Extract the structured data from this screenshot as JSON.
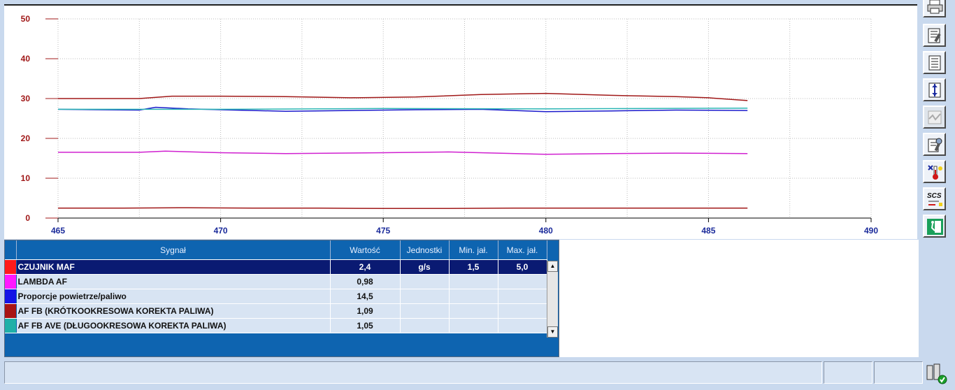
{
  "chart_data": {
    "type": "line",
    "xlim": [
      465,
      490
    ],
    "ylim": [
      0,
      50
    ],
    "x_ticks": [
      "465",
      "470",
      "475",
      "480",
      "485",
      "490"
    ],
    "y_ticks": [
      "0",
      "10",
      "20",
      "30",
      "40",
      "50"
    ],
    "grid": true,
    "series": [
      {
        "color": "#a01818",
        "x": [
          465,
          467.5,
          468.5,
          470,
          472,
          474,
          476,
          478,
          480,
          482,
          484,
          485,
          486.2
        ],
        "y": [
          30,
          30,
          30.6,
          30.6,
          30.5,
          30.2,
          30.4,
          31.0,
          31.3,
          30.8,
          30.5,
          30.2,
          29.5
        ]
      },
      {
        "color": "#1a1acc",
        "x": [
          465,
          467.5,
          468,
          469,
          470,
          472,
          474,
          476,
          478,
          480,
          482,
          484,
          486.2
        ],
        "y": [
          27.3,
          27.1,
          27.8,
          27.4,
          27.2,
          26.8,
          27.0,
          27.2,
          27.3,
          26.7,
          26.9,
          27.1,
          27.0
        ]
      },
      {
        "color": "#2ab4b4",
        "x": [
          465,
          468,
          470,
          475,
          480,
          486.2
        ],
        "y": [
          27.3,
          27.3,
          27.3,
          27.5,
          27.4,
          27.6
        ]
      },
      {
        "color": "#d020d0",
        "x": [
          465,
          467.5,
          468.3,
          470,
          472,
          475,
          477,
          480,
          482,
          484,
          486.2
        ],
        "y": [
          16.5,
          16.5,
          16.8,
          16.4,
          16.2,
          16.4,
          16.6,
          16.0,
          16.2,
          16.3,
          16.2
        ]
      },
      {
        "color": "#a01818",
        "x": [
          465,
          467,
          469,
          471,
          473,
          475,
          477,
          479,
          481,
          483,
          486.2
        ],
        "y": [
          2.5,
          2.5,
          2.6,
          2.5,
          2.5,
          2.4,
          2.4,
          2.5,
          2.5,
          2.5,
          2.5
        ]
      }
    ]
  },
  "table": {
    "headers": {
      "signal": "Sygnał",
      "value": "Wartość",
      "units": "Jednostki",
      "min": "Min. jał.",
      "max": "Max. jał."
    },
    "rows": [
      {
        "color": "#ff1a1a",
        "signal": "CZUJNIK MAF",
        "value": "2,4",
        "units": "g/s",
        "min": "1,5",
        "max": "5,0"
      },
      {
        "color": "#ff18ff",
        "signal": "LAMBDA AF",
        "value": "0,98",
        "units": "",
        "min": "",
        "max": ""
      },
      {
        "color": "#1414e6",
        "signal": "Proporcje powietrze/paliwo",
        "value": "14,5",
        "units": "",
        "min": "",
        "max": ""
      },
      {
        "color": "#a81414",
        "signal": "AF FB (KRÓTKOOKRESOWA KOREKTA PALIWA)",
        "value": "1,09",
        "units": "",
        "min": "",
        "max": ""
      },
      {
        "color": "#20b0a8",
        "signal": "AF FB AVE (DŁUGOOKRESOWA KOREKTA PALIWA)",
        "value": "1,05",
        "units": "",
        "min": "",
        "max": ""
      }
    ]
  },
  "toolbar": {
    "icons": [
      "print-icon",
      "data-list-settings-icon",
      "document-list-icon",
      "trigger-record-icon",
      "graph-disabled-icon",
      "list-settings-icon",
      "thermometer-icon",
      "scs-icon",
      "exit-icon"
    ],
    "scs_label": "SCS"
  },
  "status": {
    "connection_icon": "connection-ok-icon"
  }
}
